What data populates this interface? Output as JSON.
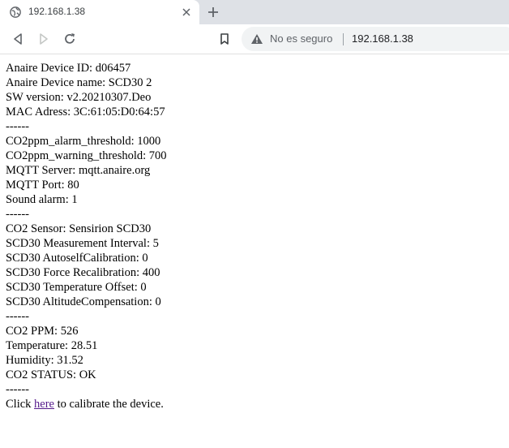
{
  "browser": {
    "tab_title": "192.168.1.38",
    "security_label": "No es seguro",
    "url": "192.168.1.38",
    "icons": [
      "globe-icon",
      "close-icon",
      "plus-icon",
      "back-arrow-icon",
      "forward-arrow-icon",
      "reload-icon",
      "bookmark-icon",
      "warning-icon"
    ]
  },
  "page": {
    "lines": [
      "Anaire Device ID: d06457",
      "Anaire Device name: SCD30 2",
      "SW version: v2.20210307.Deo",
      "MAC Adress: 3C:61:05:D0:64:57",
      "------",
      "CO2ppm_alarm_threshold: 1000",
      "CO2ppm_warning_threshold: 700",
      "MQTT Server: mqtt.anaire.org",
      "MQTT Port: 80",
      "Sound alarm: 1",
      "------",
      "CO2 Sensor: Sensirion SCD30",
      "SCD30 Measurement Interval: 5",
      "SCD30 AutoselfCalibration: 0",
      "SCD30 Force Recalibration: 400",
      "SCD30 Temperature Offset: 0",
      "SCD30 AltitudeCompensation: 0",
      "------",
      "CO2 PPM: 526",
      "Temperature: 28.51",
      "Humidity: 31.52",
      "CO2 STATUS: OK",
      "------"
    ],
    "calibrate": {
      "prefix": "Click ",
      "link_text": "here",
      "suffix": " to calibrate the device."
    }
  },
  "colors": {
    "tabstrip_bg": "#dee1e6",
    "omnibox_bg": "#f1f3f4",
    "visited_link": "#551a8b"
  }
}
